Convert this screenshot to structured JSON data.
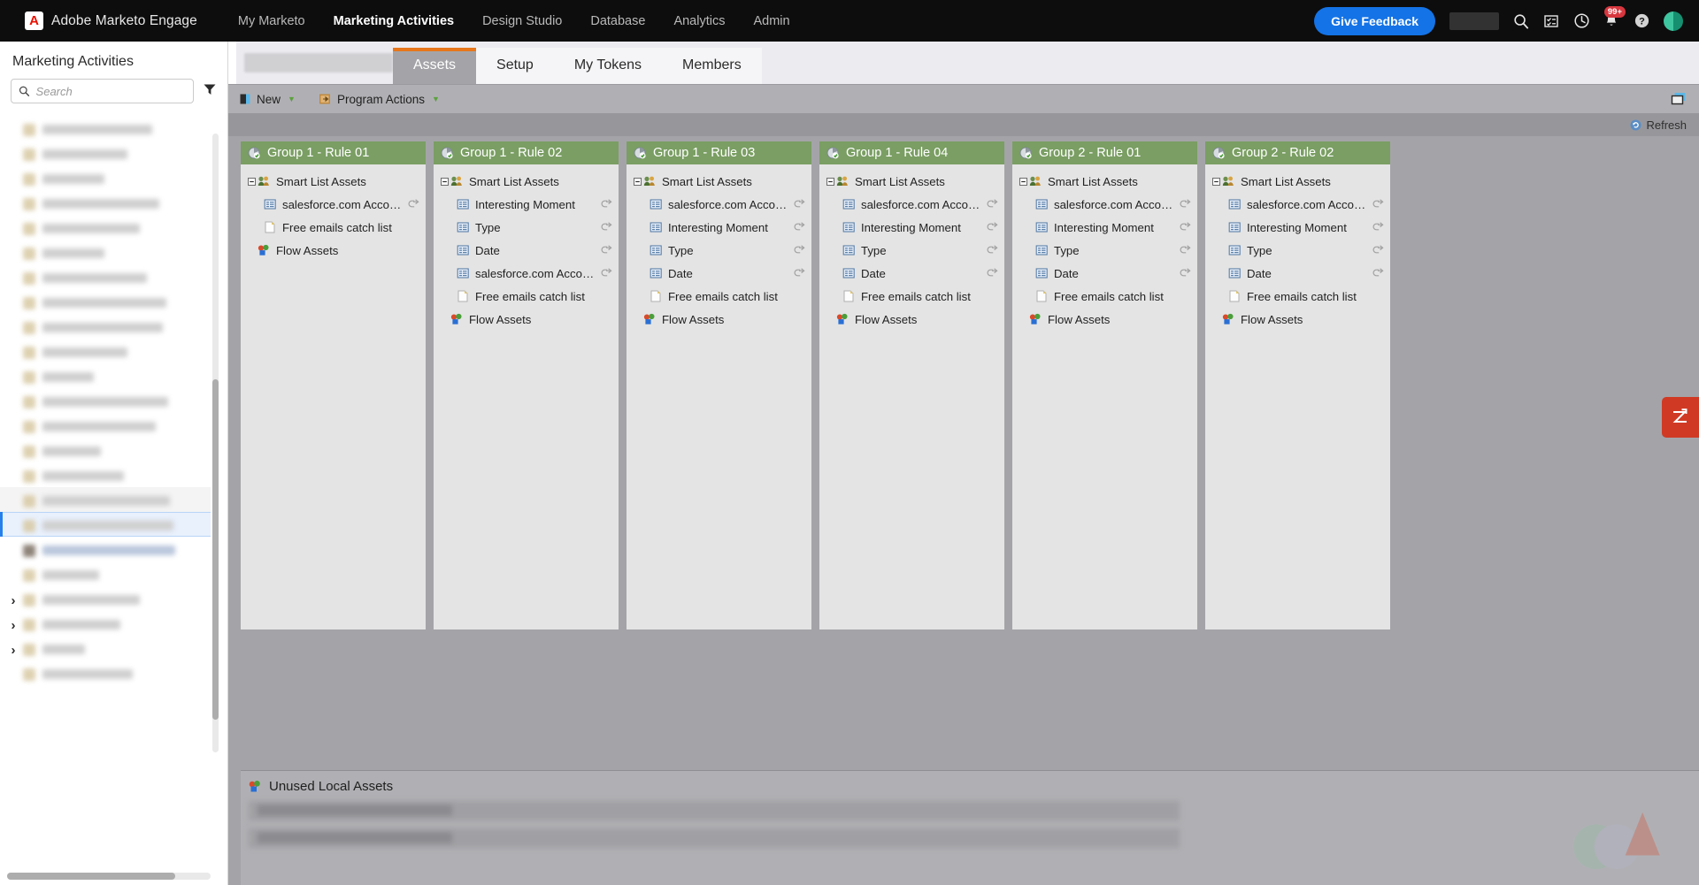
{
  "topnav": {
    "brand": "Adobe Marketo Engage",
    "logo_letter": "A",
    "items": [
      {
        "label": "My Marketo",
        "active": false
      },
      {
        "label": "Marketing Activities",
        "active": true
      },
      {
        "label": "Design Studio",
        "active": false
      },
      {
        "label": "Database",
        "active": false
      },
      {
        "label": "Analytics",
        "active": false
      },
      {
        "label": "Admin",
        "active": false
      }
    ],
    "feedback_button": "Give Feedback",
    "notification_badge": "99+",
    "icons": [
      "search-icon",
      "tasks-icon",
      "clock-icon",
      "bell-icon",
      "help-icon",
      "avatar"
    ],
    "accent_blue": "#1473e6",
    "badge_red": "#d7373f"
  },
  "sidebar": {
    "title": "Marketing Activities",
    "search": {
      "value": "",
      "placeholder": "Search"
    },
    "filter_icon": "filter-icon",
    "tree_note": "redacted program tree"
  },
  "tabs": {
    "program_name_redacted": "",
    "items": [
      {
        "label": "Assets",
        "active": true
      },
      {
        "label": "Setup",
        "active": false
      },
      {
        "label": "My Tokens",
        "active": false
      },
      {
        "label": "Members",
        "active": false
      }
    ],
    "active_accent": "#e8761a"
  },
  "toolbar": {
    "new_label": "New",
    "program_actions_label": "Program Actions",
    "panel_toggle_icon": "window-panel-icon"
  },
  "refresh": {
    "label": "Refresh",
    "icon": "refresh-icon"
  },
  "columns": [
    {
      "title": "Group 1 - Rule 01",
      "nodes": [
        {
          "label": "Smart List Assets",
          "level": 1,
          "icon": "smart-list-icon",
          "toggle": "collapse",
          "link": false
        },
        {
          "label": "salesforce.com Account_...",
          "level": 2,
          "icon": "list-icon",
          "link": true
        },
        {
          "label": "Free emails catch list",
          "level": 2,
          "icon": "document-icon",
          "link": false
        },
        {
          "label": "Flow Assets",
          "level": 1,
          "icon": "flow-icon",
          "toggle": "none",
          "link": false
        }
      ]
    },
    {
      "title": "Group 1 - Rule 02",
      "nodes": [
        {
          "label": "Smart List Assets",
          "level": 1,
          "icon": "smart-list-icon",
          "toggle": "collapse",
          "link": false
        },
        {
          "label": "Interesting Moment",
          "level": 2,
          "icon": "list-icon",
          "link": true
        },
        {
          "label": "Type",
          "level": 2,
          "icon": "list-icon",
          "link": true
        },
        {
          "label": "Date",
          "level": 2,
          "icon": "list-icon",
          "link": true
        },
        {
          "label": "salesforce.com Account_...",
          "level": 2,
          "icon": "list-icon",
          "link": true
        },
        {
          "label": "Free emails catch list",
          "level": 2,
          "icon": "document-icon",
          "link": false
        },
        {
          "label": "Flow Assets",
          "level": 1,
          "icon": "flow-icon",
          "toggle": "none",
          "link": false
        }
      ]
    },
    {
      "title": "Group 1 - Rule 03",
      "nodes": [
        {
          "label": "Smart List Assets",
          "level": 1,
          "icon": "smart-list-icon",
          "toggle": "collapse",
          "link": false
        },
        {
          "label": "salesforce.com Account_...",
          "level": 2,
          "icon": "list-icon",
          "link": true
        },
        {
          "label": "Interesting Moment",
          "level": 2,
          "icon": "list-icon",
          "link": true
        },
        {
          "label": "Type",
          "level": 2,
          "icon": "list-icon",
          "link": true
        },
        {
          "label": "Date",
          "level": 2,
          "icon": "list-icon",
          "link": true
        },
        {
          "label": "Free emails catch list",
          "level": 2,
          "icon": "document-icon",
          "link": false
        },
        {
          "label": "Flow Assets",
          "level": 1,
          "icon": "flow-icon",
          "toggle": "none",
          "link": false
        }
      ]
    },
    {
      "title": "Group 1 - Rule 04",
      "nodes": [
        {
          "label": "Smart List Assets",
          "level": 1,
          "icon": "smart-list-icon",
          "toggle": "collapse",
          "link": false
        },
        {
          "label": "salesforce.com Account_...",
          "level": 2,
          "icon": "list-icon",
          "link": true
        },
        {
          "label": "Interesting Moment",
          "level": 2,
          "icon": "list-icon",
          "link": true
        },
        {
          "label": "Type",
          "level": 2,
          "icon": "list-icon",
          "link": true
        },
        {
          "label": "Date",
          "level": 2,
          "icon": "list-icon",
          "link": true
        },
        {
          "label": "Free emails catch list",
          "level": 2,
          "icon": "document-icon",
          "link": false
        },
        {
          "label": "Flow Assets",
          "level": 1,
          "icon": "flow-icon",
          "toggle": "none",
          "link": false
        }
      ]
    },
    {
      "title": "Group 2 - Rule 01",
      "nodes": [
        {
          "label": "Smart List Assets",
          "level": 1,
          "icon": "smart-list-icon",
          "toggle": "collapse",
          "link": false
        },
        {
          "label": "salesforce.com Account_...",
          "level": 2,
          "icon": "list-icon",
          "link": true
        },
        {
          "label": "Interesting Moment",
          "level": 2,
          "icon": "list-icon",
          "link": true
        },
        {
          "label": "Type",
          "level": 2,
          "icon": "list-icon",
          "link": true
        },
        {
          "label": "Date",
          "level": 2,
          "icon": "list-icon",
          "link": true
        },
        {
          "label": "Free emails catch list",
          "level": 2,
          "icon": "document-icon",
          "link": false
        },
        {
          "label": "Flow Assets",
          "level": 1,
          "icon": "flow-icon",
          "toggle": "none",
          "link": false
        }
      ]
    },
    {
      "title": "Group 2 - Rule 02",
      "nodes": [
        {
          "label": "Smart List Assets",
          "level": 1,
          "icon": "smart-list-icon",
          "toggle": "collapse",
          "link": false
        },
        {
          "label": "salesforce.com Account_...",
          "level": 2,
          "icon": "list-icon",
          "link": true
        },
        {
          "label": "Interesting Moment",
          "level": 2,
          "icon": "list-icon",
          "link": true
        },
        {
          "label": "Type",
          "level": 2,
          "icon": "list-icon",
          "link": true
        },
        {
          "label": "Date",
          "level": 2,
          "icon": "list-icon",
          "link": true
        },
        {
          "label": "Free emails catch list",
          "level": 2,
          "icon": "document-icon",
          "link": false
        },
        {
          "label": "Flow Assets",
          "level": 1,
          "icon": "flow-icon",
          "toggle": "none",
          "link": false
        }
      ]
    }
  ],
  "column_header_color": "#7a9e63",
  "unused": {
    "title": "Unused Local Assets",
    "icon": "flow-icon"
  },
  "fab": {
    "icon": "expand-z-icon",
    "color": "#d03a24"
  }
}
